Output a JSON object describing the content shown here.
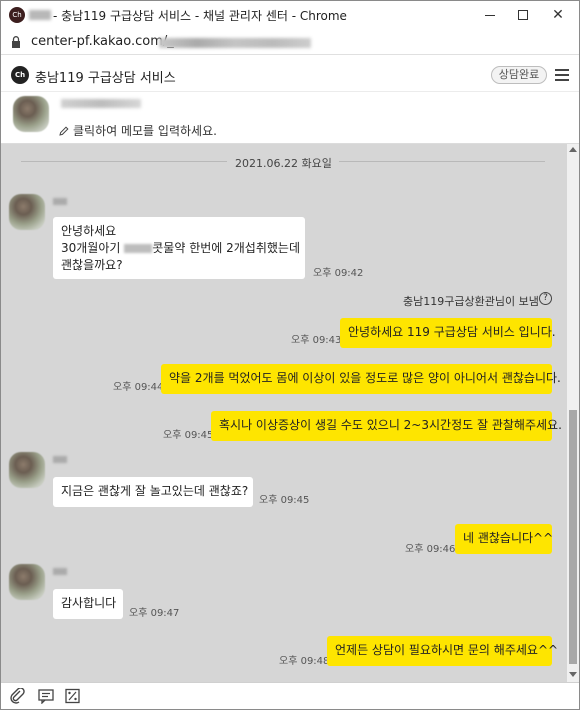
{
  "window": {
    "title": "- 충남119 구급상담 서비스 - 채널 관리자 센터 - Chrome",
    "title_icon": "Ch"
  },
  "address": {
    "url": "center-pf.kakao.com/_"
  },
  "header": {
    "logo": "Ch",
    "title": "충남119 구급상담 서비스",
    "status": "상담완료"
  },
  "profile": {
    "memo_placeholder": "클릭하여 메모를 입력하세요."
  },
  "chat": {
    "date": "2021.06.22 화요일",
    "sent_by": "충남119구급상환관님이 보냄",
    "messages": [
      {
        "side": "in",
        "line1": "안녕하세요",
        "line2a": "30개월아기",
        "line2b": "콧물약 한번에 2개섭취했는데",
        "line3": "괜찮을까요?",
        "time": "오후 09:42"
      },
      {
        "side": "out",
        "text": "안녕하세요 119 구급상담 서비스 입니다.",
        "time": "오후 09:43"
      },
      {
        "side": "out",
        "text": "약을 2개를 먹었어도 몸에 이상이 있을 정도로 많은 양이 아니어서 괜찮습니다.",
        "time": "오후 09:44"
      },
      {
        "side": "out",
        "text": "혹시나 이상증상이 생길 수도 있으니 2~3시간정도 잘 관찰해주세요.",
        "time": "오후 09:45"
      },
      {
        "side": "in",
        "text": "지금은 괜찮게 잘 놀고있는데 괜찮죠?",
        "time": "오후 09:45"
      },
      {
        "side": "out",
        "text": "네 괜찮습니다^^",
        "time": "오후 09:46"
      },
      {
        "side": "in",
        "text": "감사합니다",
        "time": "오후 09:47"
      },
      {
        "side": "out",
        "text": "언제든 상담이 필요하시면 문의 해주세요^^",
        "time": "오후 09:48"
      }
    ]
  },
  "toolbar": {
    "icons": [
      "attach-icon",
      "template-icon",
      "emoticon-icon"
    ]
  },
  "colors": {
    "chat_background": "#d6d6d6",
    "my_bubble": "#fee500",
    "their_bubble": "#ffffff"
  }
}
